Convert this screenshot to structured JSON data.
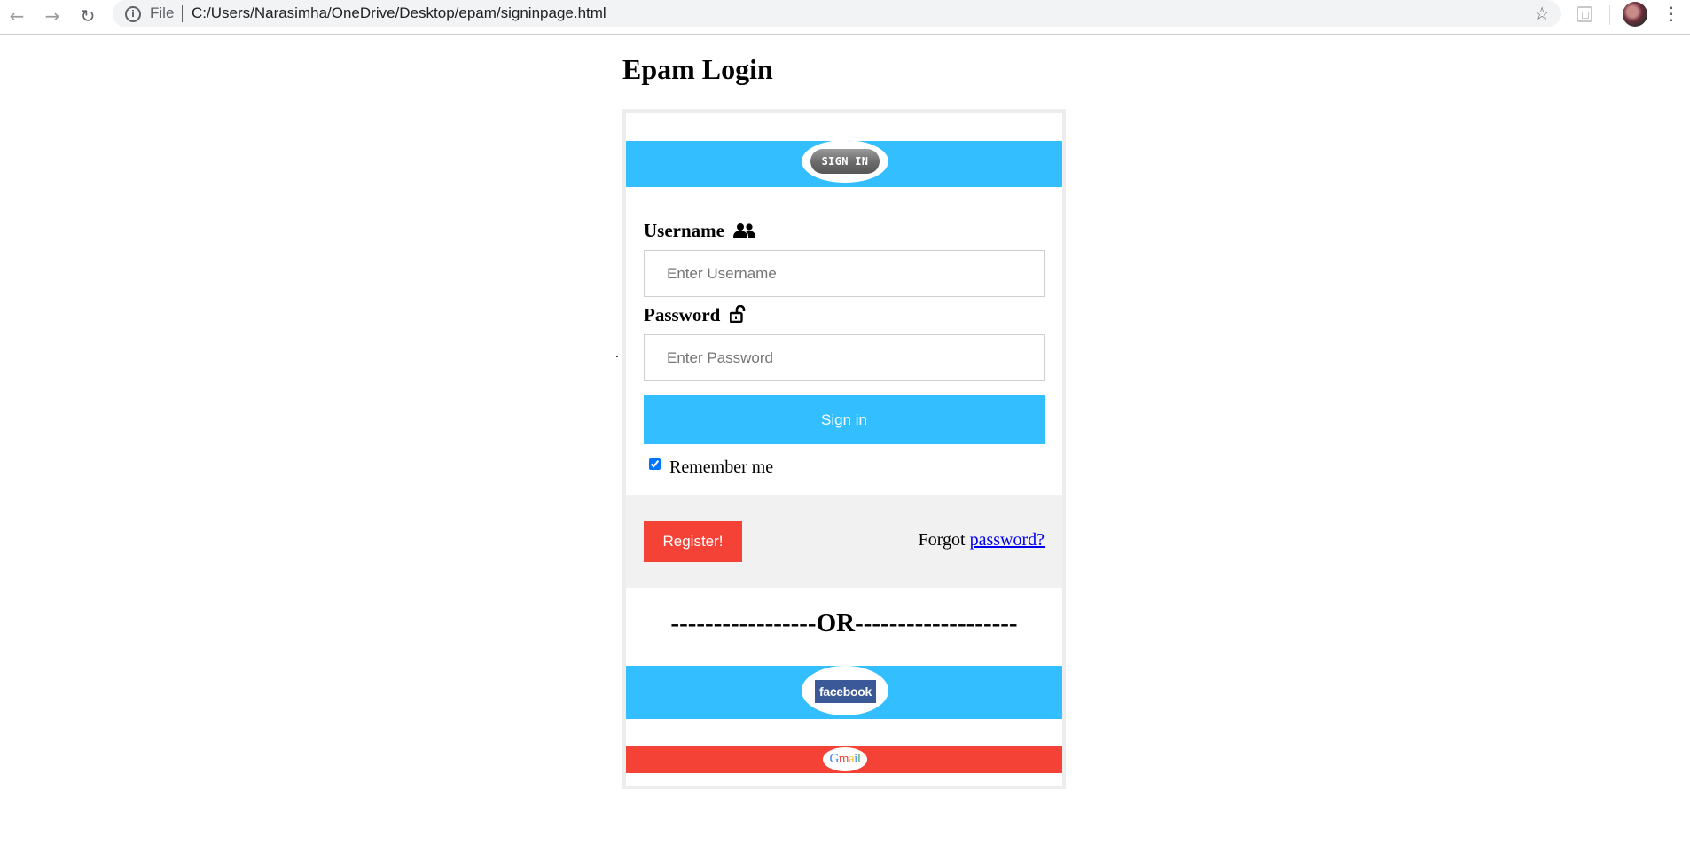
{
  "browser": {
    "back_icon": "arrow-left-icon",
    "forward_icon": "arrow-right-icon",
    "reload_icon": "reload-icon",
    "file_label": "File",
    "url": "C:/Users/Narasimha/OneDrive/Desktop/epam/signinpage.html"
  },
  "page": {
    "title": "Epam Login",
    "stray_mark": "."
  },
  "login": {
    "signin_badge": "SIGN IN",
    "username_label": "Username",
    "username_placeholder": "Enter Username",
    "password_label": "Password",
    "password_placeholder": "Enter Password",
    "signin_button": "Sign in",
    "remember_label": "Remember me",
    "remember_checked": true,
    "register_button": "Register!",
    "forgot_prefix": "Forgot ",
    "forgot_link": "password?",
    "or_divider": "-----------------OR-------------------",
    "facebook_label": "facebook",
    "gmail_label": "Gmail"
  },
  "colors": {
    "accent_blue": "#33bfff",
    "register_red": "#f44336",
    "facebook_blue": "#3b5998",
    "link_blue": "#0000ee",
    "footer_gray": "#f1f1f1"
  }
}
